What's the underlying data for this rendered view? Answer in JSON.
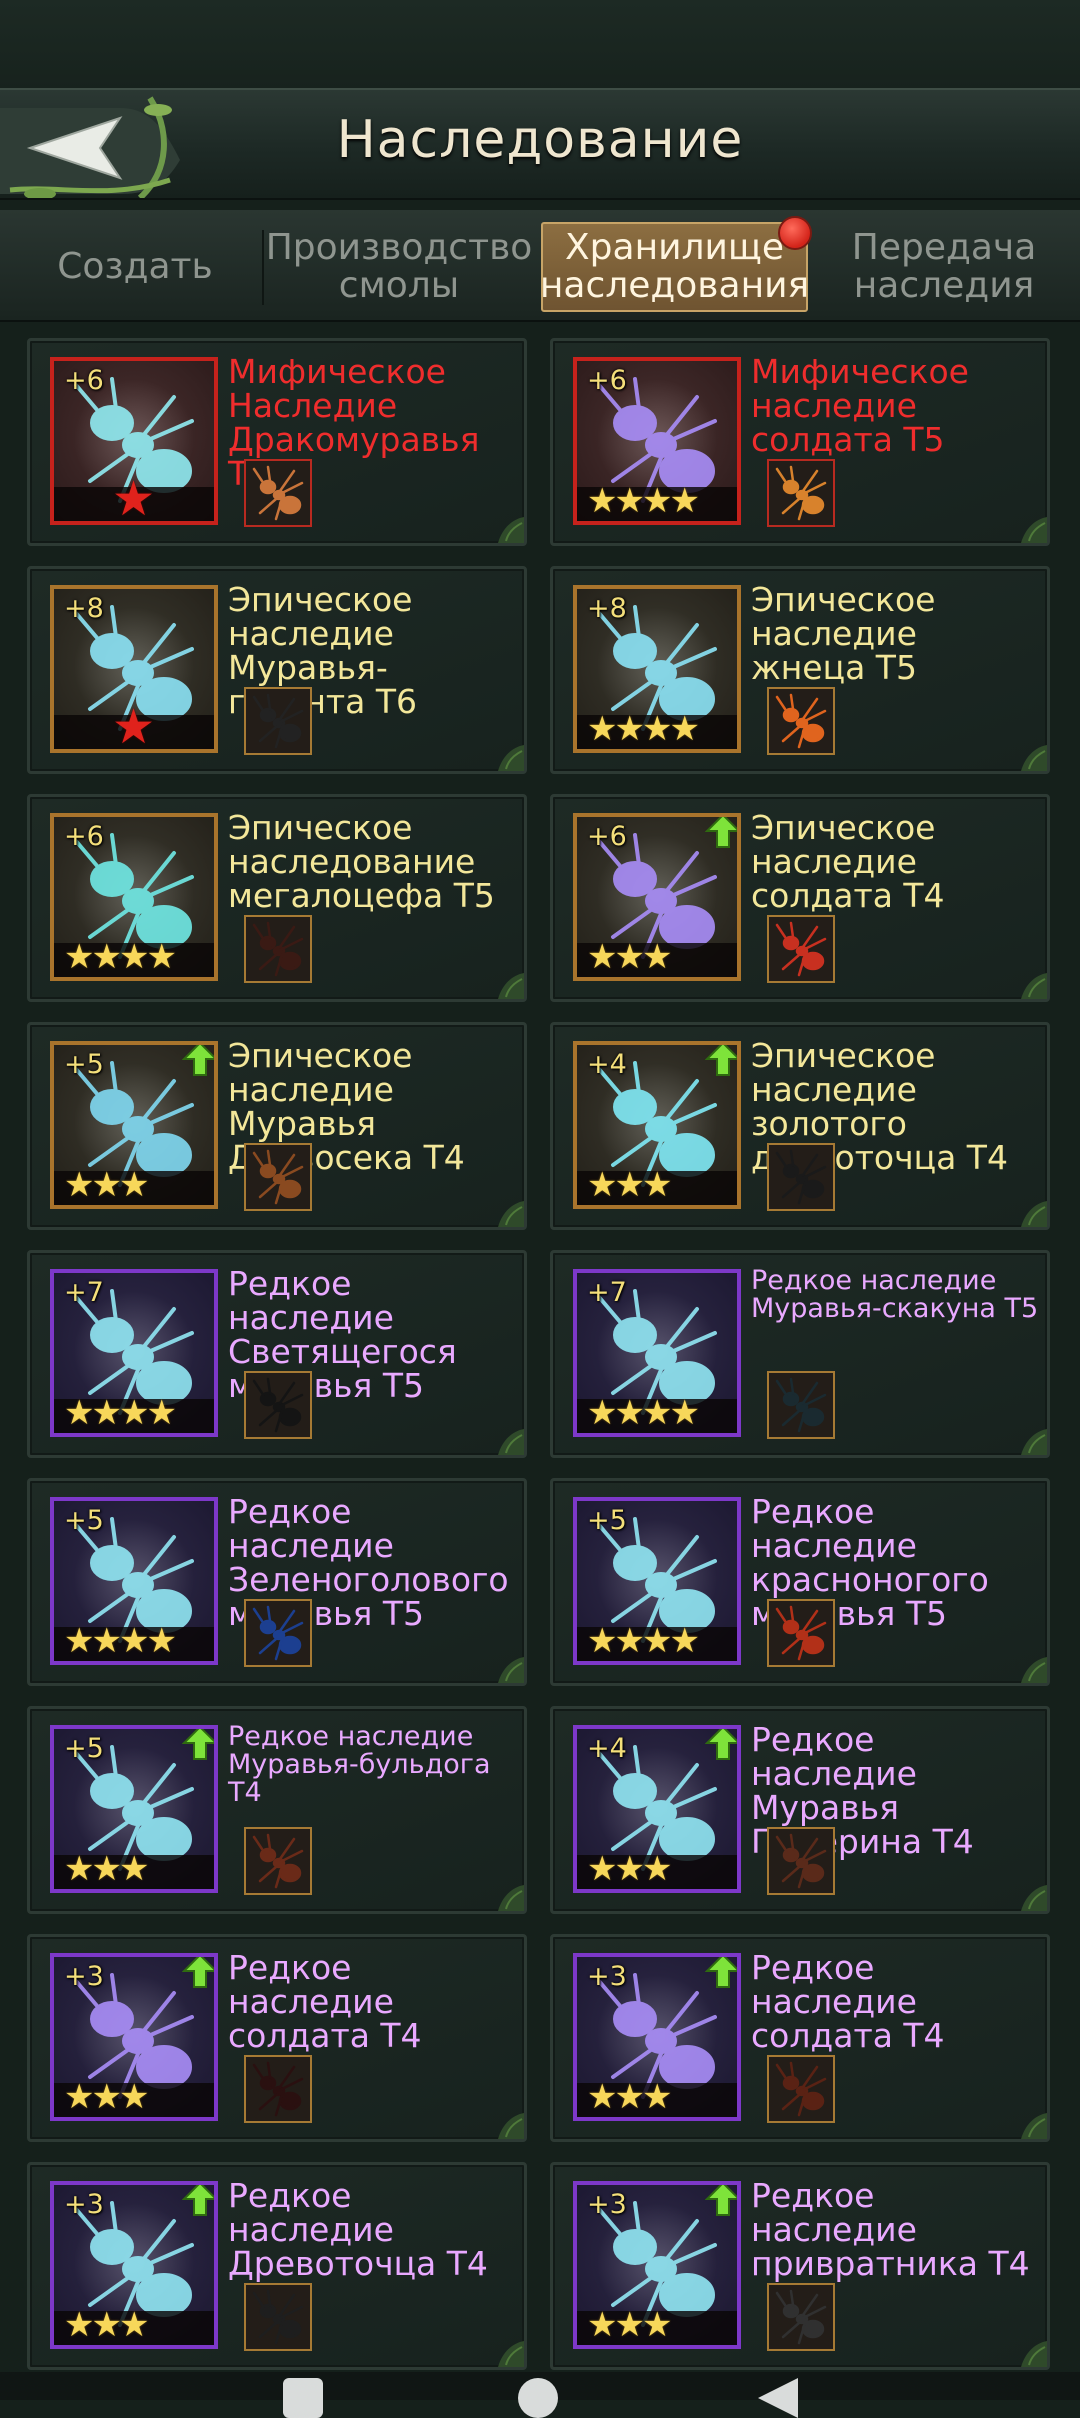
{
  "header": {
    "title": "Наследование",
    "back_icon": "back-arrow-icon"
  },
  "tabs": [
    {
      "label": "Создать",
      "active": false
    },
    {
      "label": "Производство смолы",
      "active": false
    },
    {
      "label": "Хранилище наследования",
      "active": true,
      "badge": true
    },
    {
      "label": "Передача наследия",
      "active": false
    }
  ],
  "items": [
    {
      "title": "Мифическое Наследие Дракомуравья Т6",
      "level": "+6",
      "rarity": "mythic",
      "stars": 0,
      "red_star": true,
      "upgrade": false,
      "art": "#8fe8ee",
      "mini": "#c9743a"
    },
    {
      "title": "Мифическое наследие солдата Т5",
      "level": "+6",
      "rarity": "mythic",
      "stars": 4,
      "red_star": false,
      "upgrade": false,
      "art": "#a78cf5",
      "mini": "#d8822c"
    },
    {
      "title": "Эпическое наследие Муравья-гиганта Т6",
      "level": "+8",
      "rarity": "epic",
      "stars": 0,
      "red_star": true,
      "upgrade": false,
      "art": "#8ae0f2",
      "mini": "#222222"
    },
    {
      "title": "Эпическое наследие жнеца Т5",
      "level": "+8",
      "rarity": "epic",
      "stars": 4,
      "red_star": false,
      "upgrade": false,
      "art": "#8ae0f2",
      "mini": "#e0641e"
    },
    {
      "title": "Эпическое наследование мегалоцефа Т5",
      "level": "+6",
      "rarity": "epic",
      "stars": 4,
      "red_star": false,
      "upgrade": false,
      "art": "#6fe6e2",
      "mini": "#3a1a14"
    },
    {
      "title": "Эпическое наследие солдата Т4",
      "level": "+6",
      "rarity": "epic",
      "stars": 3,
      "red_star": false,
      "upgrade": true,
      "art": "#a78cf5",
      "mini": "#c83020"
    },
    {
      "title": "Эпическое наследие Муравья Дровосека Т4",
      "level": "+5",
      "rarity": "epic",
      "stars": 3,
      "red_star": false,
      "upgrade": true,
      "art": "#7fd6ee",
      "mini": "#8a4a20"
    },
    {
      "title": "Эпическое наследие золотого древоточца Т4",
      "level": "+4",
      "rarity": "epic",
      "stars": 3,
      "red_star": false,
      "upgrade": true,
      "art": "#7fe6f2",
      "mini": "#1a1a1a"
    },
    {
      "title": "Редкое наследие Светящегося муравья Т5",
      "level": "+7",
      "rarity": "rare",
      "stars": 4,
      "red_star": false,
      "upgrade": false,
      "art": "#8fe3f0",
      "mini": "#141414"
    },
    {
      "title": "Редкое наследие Муравья-скакуна Т5",
      "level": "+7",
      "rarity": "rare",
      "stars": 4,
      "red_star": false,
      "upgrade": false,
      "art": "#8fe3f0",
      "mini": "#1a2a30",
      "small": true
    },
    {
      "title": "Редкое наследие Зеленоголового муравья Т5",
      "level": "+5",
      "rarity": "rare",
      "stars": 4,
      "red_star": false,
      "upgrade": false,
      "art": "#8fe3f0",
      "mini": "#1c3f90"
    },
    {
      "title": "Редкое наследие красноногого муравья Т5",
      "level": "+5",
      "rarity": "rare",
      "stars": 4,
      "red_star": false,
      "upgrade": false,
      "art": "#8fe3f0",
      "mini": "#b23018"
    },
    {
      "title": "Редкое наследие Муравья-бульдога Т4",
      "level": "+5",
      "rarity": "rare",
      "stars": 3,
      "red_star": false,
      "upgrade": true,
      "art": "#8fe3f0",
      "mini": "#6a2a18",
      "small": true
    },
    {
      "title": "Редкое наследие Муравья Понерина Т4",
      "level": "+4",
      "rarity": "rare",
      "stars": 3,
      "red_star": false,
      "upgrade": true,
      "art": "#8fe3f0",
      "mini": "#5a2a1a"
    },
    {
      "title": "Редкое наследие солдата Т4",
      "level": "+3",
      "rarity": "rare",
      "stars": 3,
      "red_star": false,
      "upgrade": true,
      "art": "#a78cf5",
      "mini": "#2a1010"
    },
    {
      "title": "Редкое наследие солдата Т4",
      "level": "+3",
      "rarity": "rare",
      "stars": 3,
      "red_star": false,
      "upgrade": true,
      "art": "#a78cf5",
      "mini": "#5a2214"
    },
    {
      "title": "Редкое наследие Древоточца Т4",
      "level": "+3",
      "rarity": "rare",
      "stars": 3,
      "red_star": false,
      "upgrade": true,
      "art": "#8fe3f0",
      "mini": "#1e1e1e"
    },
    {
      "title": "Редкое наследие привратника Т4",
      "level": "+3",
      "rarity": "rare",
      "stars": 3,
      "red_star": false,
      "upgrade": true,
      "art": "#8fe3f0",
      "mini": "#303030"
    }
  ]
}
